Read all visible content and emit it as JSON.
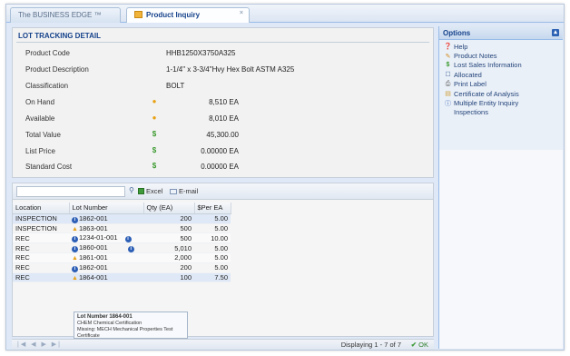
{
  "tabs": [
    {
      "label": "The BUSINESS EDGE ™"
    },
    {
      "label": "Product Inquiry",
      "close": "×"
    }
  ],
  "lot_detail": {
    "title": "LOT TRACKING DETAIL",
    "fields": {
      "product_code": {
        "label": "Product Code",
        "value": "HHB1250X3750A325"
      },
      "product_description": {
        "label": "Product Description",
        "value": "1-1/4\" x 3-3/4\"Hvy Hex Bolt ASTM A325"
      },
      "classification": {
        "label": "Classification",
        "value": "BOLT"
      },
      "on_hand": {
        "label": "On Hand",
        "value": "8,510 EA"
      },
      "available": {
        "label": "Available",
        "value": "8,010 EA"
      },
      "total_value": {
        "label": "Total Value",
        "value": "45,300.00"
      },
      "list_price": {
        "label": "List Price",
        "value": "0.00000 EA"
      },
      "standard_cost": {
        "label": "Standard Cost",
        "value": "0.00000 EA"
      }
    }
  },
  "toolbar": {
    "search_placeholder": "",
    "excel_label": "Excel",
    "email_label": "E-mail"
  },
  "grid": {
    "columns": {
      "location": "Location",
      "lot_number": "Lot Number",
      "qty": "Qty (EA)",
      "per_ea": "$Per EA"
    },
    "rows": [
      {
        "location": "INSPECTION",
        "lot": "1862-001",
        "qty": "200",
        "per": "5.00"
      },
      {
        "location": "INSPECTION",
        "lot": "1863-001",
        "qty": "500",
        "per": "5.00"
      },
      {
        "location": "REC",
        "lot": "1234-01-001",
        "qty": "500",
        "per": "10.00"
      },
      {
        "location": "REC",
        "lot": "1860-001",
        "qty": "5,010",
        "per": "5.00"
      },
      {
        "location": "REC",
        "lot": "1861-001",
        "qty": "2,000",
        "per": "5.00"
      },
      {
        "location": "REC",
        "lot": "1862-001",
        "qty": "200",
        "per": "5.00"
      },
      {
        "location": "REC",
        "lot": "1864-001",
        "qty": "100",
        "per": "7.50"
      }
    ]
  },
  "tooltip": {
    "title": "Lot Number 1864-001",
    "line1": "CHEM Chemical Certification",
    "line2": "Missing: MECH Mechanical Properties Test Certificate"
  },
  "pager": {
    "nav": "|◀ ◀ ▶ ▶|",
    "display": "Displaying 1 - 7 of 7",
    "ok": "OK"
  },
  "options": {
    "title": "Options",
    "collapse": "▴",
    "items": [
      {
        "label": "Help",
        "icon": "help-icon",
        "glyph": "❓"
      },
      {
        "label": "Product Notes",
        "icon": "pencil-icon",
        "glyph": "✎"
      },
      {
        "label": "Lost Sales Information",
        "icon": "dollar-icon",
        "glyph": "$"
      },
      {
        "label": "Allocated",
        "icon": "checkbox-icon",
        "glyph": "☐"
      },
      {
        "label": "Print Label",
        "icon": "printer-icon",
        "glyph": "⎙"
      },
      {
        "label": "Certificate of Analysis",
        "icon": "certificate-icon",
        "glyph": "▤"
      },
      {
        "label": "Multiple Entity Inquiry",
        "icon": "info-icon",
        "glyph": "ⓘ"
      },
      {
        "label": "Inspections",
        "icon": "",
        "glyph": ""
      }
    ]
  },
  "colors": {
    "accent": "#15428b",
    "panel": "#dfe8f6",
    "warning": "#e7a21a",
    "money": "#3b9a2e"
  }
}
